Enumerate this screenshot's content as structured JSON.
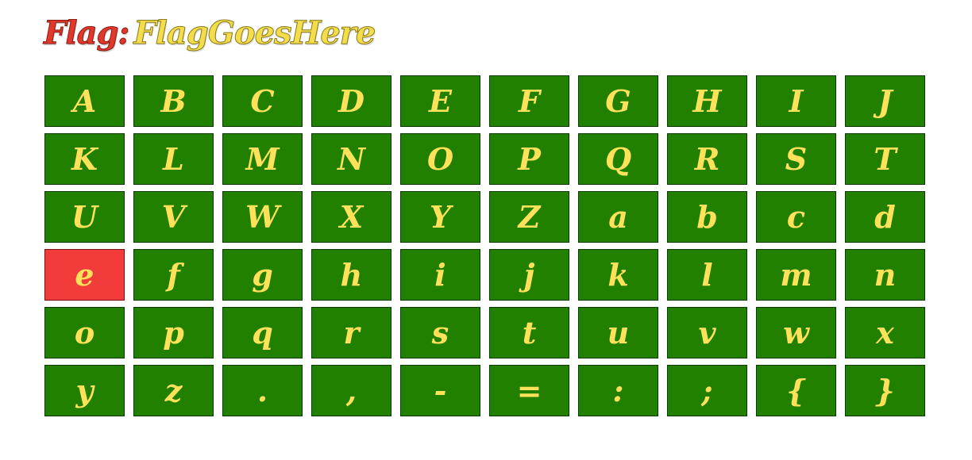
{
  "flag": {
    "label": "Flag:",
    "value": "FlagGoesHere"
  },
  "keyboard": {
    "active_key": "e",
    "keys": [
      "A",
      "B",
      "C",
      "D",
      "E",
      "F",
      "G",
      "H",
      "I",
      "J",
      "K",
      "L",
      "M",
      "N",
      "O",
      "P",
      "Q",
      "R",
      "S",
      "T",
      "U",
      "V",
      "W",
      "X",
      "Y",
      "Z",
      "a",
      "b",
      "c",
      "d",
      "e",
      "f",
      "g",
      "h",
      "i",
      "j",
      "k",
      "l",
      "m",
      "n",
      "o",
      "p",
      "q",
      "r",
      "s",
      "t",
      "u",
      "v",
      "w",
      "x",
      "y",
      "z",
      ".",
      ",",
      "-",
      "=",
      ":",
      ";",
      "{",
      "}"
    ]
  },
  "colors": {
    "label": "#e2372b",
    "value": "#f4dd4a",
    "key_background": "#228000",
    "key_text": "#ffe15a",
    "key_active_background": "#f23b3b"
  }
}
